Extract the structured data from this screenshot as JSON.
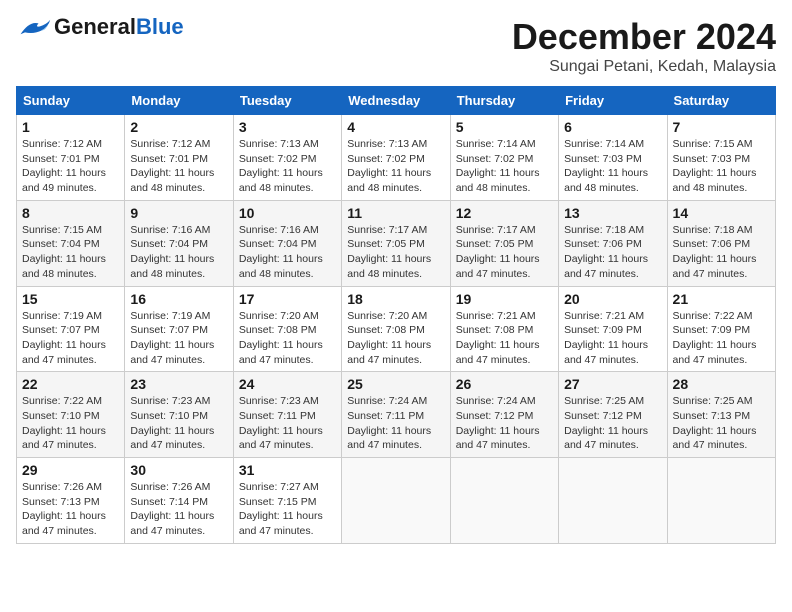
{
  "header": {
    "logo_line1": "General",
    "logo_line2": "Blue",
    "month": "December 2024",
    "location": "Sungai Petani, Kedah, Malaysia"
  },
  "weekdays": [
    "Sunday",
    "Monday",
    "Tuesday",
    "Wednesday",
    "Thursday",
    "Friday",
    "Saturday"
  ],
  "weeks": [
    [
      {
        "day": "1",
        "info": "Sunrise: 7:12 AM\nSunset: 7:01 PM\nDaylight: 11 hours\nand 49 minutes."
      },
      {
        "day": "2",
        "info": "Sunrise: 7:12 AM\nSunset: 7:01 PM\nDaylight: 11 hours\nand 48 minutes."
      },
      {
        "day": "3",
        "info": "Sunrise: 7:13 AM\nSunset: 7:02 PM\nDaylight: 11 hours\nand 48 minutes."
      },
      {
        "day": "4",
        "info": "Sunrise: 7:13 AM\nSunset: 7:02 PM\nDaylight: 11 hours\nand 48 minutes."
      },
      {
        "day": "5",
        "info": "Sunrise: 7:14 AM\nSunset: 7:02 PM\nDaylight: 11 hours\nand 48 minutes."
      },
      {
        "day": "6",
        "info": "Sunrise: 7:14 AM\nSunset: 7:03 PM\nDaylight: 11 hours\nand 48 minutes."
      },
      {
        "day": "7",
        "info": "Sunrise: 7:15 AM\nSunset: 7:03 PM\nDaylight: 11 hours\nand 48 minutes."
      }
    ],
    [
      {
        "day": "8",
        "info": "Sunrise: 7:15 AM\nSunset: 7:04 PM\nDaylight: 11 hours\nand 48 minutes."
      },
      {
        "day": "9",
        "info": "Sunrise: 7:16 AM\nSunset: 7:04 PM\nDaylight: 11 hours\nand 48 minutes."
      },
      {
        "day": "10",
        "info": "Sunrise: 7:16 AM\nSunset: 7:04 PM\nDaylight: 11 hours\nand 48 minutes."
      },
      {
        "day": "11",
        "info": "Sunrise: 7:17 AM\nSunset: 7:05 PM\nDaylight: 11 hours\nand 48 minutes."
      },
      {
        "day": "12",
        "info": "Sunrise: 7:17 AM\nSunset: 7:05 PM\nDaylight: 11 hours\nand 47 minutes."
      },
      {
        "day": "13",
        "info": "Sunrise: 7:18 AM\nSunset: 7:06 PM\nDaylight: 11 hours\nand 47 minutes."
      },
      {
        "day": "14",
        "info": "Sunrise: 7:18 AM\nSunset: 7:06 PM\nDaylight: 11 hours\nand 47 minutes."
      }
    ],
    [
      {
        "day": "15",
        "info": "Sunrise: 7:19 AM\nSunset: 7:07 PM\nDaylight: 11 hours\nand 47 minutes."
      },
      {
        "day": "16",
        "info": "Sunrise: 7:19 AM\nSunset: 7:07 PM\nDaylight: 11 hours\nand 47 minutes."
      },
      {
        "day": "17",
        "info": "Sunrise: 7:20 AM\nSunset: 7:08 PM\nDaylight: 11 hours\nand 47 minutes."
      },
      {
        "day": "18",
        "info": "Sunrise: 7:20 AM\nSunset: 7:08 PM\nDaylight: 11 hours\nand 47 minutes."
      },
      {
        "day": "19",
        "info": "Sunrise: 7:21 AM\nSunset: 7:08 PM\nDaylight: 11 hours\nand 47 minutes."
      },
      {
        "day": "20",
        "info": "Sunrise: 7:21 AM\nSunset: 7:09 PM\nDaylight: 11 hours\nand 47 minutes."
      },
      {
        "day": "21",
        "info": "Sunrise: 7:22 AM\nSunset: 7:09 PM\nDaylight: 11 hours\nand 47 minutes."
      }
    ],
    [
      {
        "day": "22",
        "info": "Sunrise: 7:22 AM\nSunset: 7:10 PM\nDaylight: 11 hours\nand 47 minutes."
      },
      {
        "day": "23",
        "info": "Sunrise: 7:23 AM\nSunset: 7:10 PM\nDaylight: 11 hours\nand 47 minutes."
      },
      {
        "day": "24",
        "info": "Sunrise: 7:23 AM\nSunset: 7:11 PM\nDaylight: 11 hours\nand 47 minutes."
      },
      {
        "day": "25",
        "info": "Sunrise: 7:24 AM\nSunset: 7:11 PM\nDaylight: 11 hours\nand 47 minutes."
      },
      {
        "day": "26",
        "info": "Sunrise: 7:24 AM\nSunset: 7:12 PM\nDaylight: 11 hours\nand 47 minutes."
      },
      {
        "day": "27",
        "info": "Sunrise: 7:25 AM\nSunset: 7:12 PM\nDaylight: 11 hours\nand 47 minutes."
      },
      {
        "day": "28",
        "info": "Sunrise: 7:25 AM\nSunset: 7:13 PM\nDaylight: 11 hours\nand 47 minutes."
      }
    ],
    [
      {
        "day": "29",
        "info": "Sunrise: 7:26 AM\nSunset: 7:13 PM\nDaylight: 11 hours\nand 47 minutes."
      },
      {
        "day": "30",
        "info": "Sunrise: 7:26 AM\nSunset: 7:14 PM\nDaylight: 11 hours\nand 47 minutes."
      },
      {
        "day": "31",
        "info": "Sunrise: 7:27 AM\nSunset: 7:15 PM\nDaylight: 11 hours\nand 47 minutes."
      },
      {
        "day": "",
        "info": ""
      },
      {
        "day": "",
        "info": ""
      },
      {
        "day": "",
        "info": ""
      },
      {
        "day": "",
        "info": ""
      }
    ]
  ]
}
